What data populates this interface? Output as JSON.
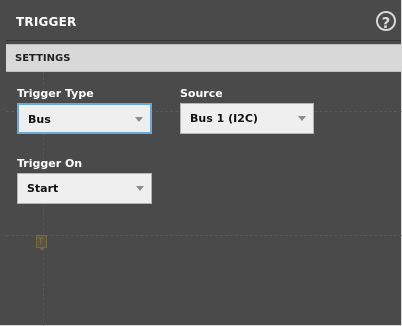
{
  "panel": {
    "title": "TRIGGER",
    "help_icon": "help-circle-icon",
    "help_glyph": "?"
  },
  "section": {
    "title": "SETTINGS"
  },
  "fields": {
    "trigger_type": {
      "label": "Trigger Type",
      "value": "Bus",
      "icon": "chevron-down-icon"
    },
    "source": {
      "label": "Source",
      "value": "Bus 1 (I2C)",
      "icon": "chevron-down-icon"
    },
    "trigger_on": {
      "label": "Trigger On",
      "value": "Start",
      "icon": "chevron-down-icon"
    }
  },
  "colors": {
    "panel_bg": "#4a4a4a",
    "section_bg": "#d8d8d8",
    "select_bg": "#efefef",
    "focus_border": "#6aa9db",
    "marker": "#8a7640"
  },
  "marker": {
    "icon": "trigger-level-marker-icon",
    "glyph": "T"
  }
}
